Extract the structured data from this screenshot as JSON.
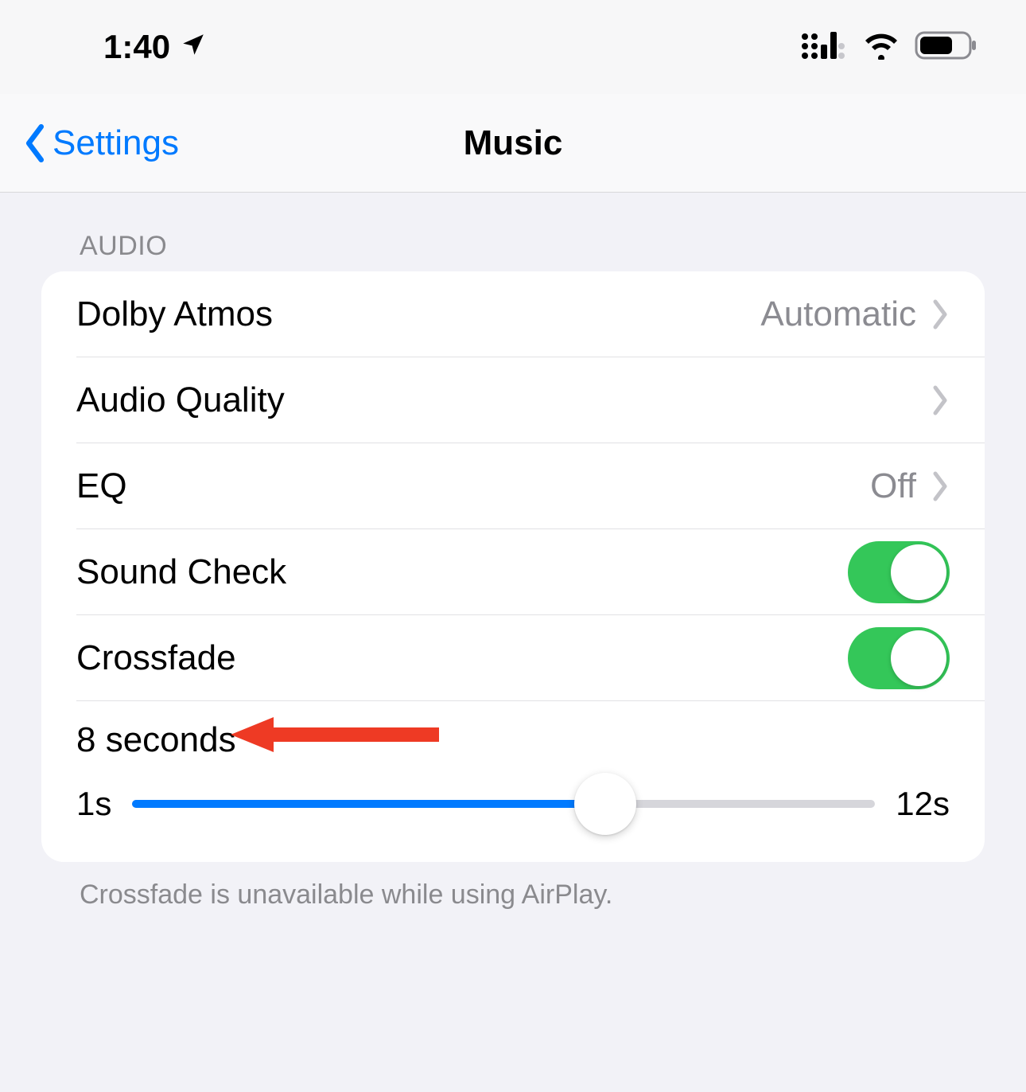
{
  "status": {
    "time": "1:40"
  },
  "nav": {
    "back_label": "Settings",
    "title": "Music"
  },
  "audio": {
    "header": "AUDIO",
    "rows": {
      "dolby_label": "Dolby Atmos",
      "dolby_value": "Automatic",
      "quality_label": "Audio Quality",
      "eq_label": "EQ",
      "eq_value": "Off",
      "sound_check_label": "Sound Check",
      "crossfade_label": "Crossfade"
    },
    "slider": {
      "value_label": "8 seconds",
      "min_label": "1s",
      "max_label": "12s",
      "min": 1,
      "max": 12,
      "value": 8
    },
    "footer": "Crossfade is unavailable while using AirPlay."
  }
}
